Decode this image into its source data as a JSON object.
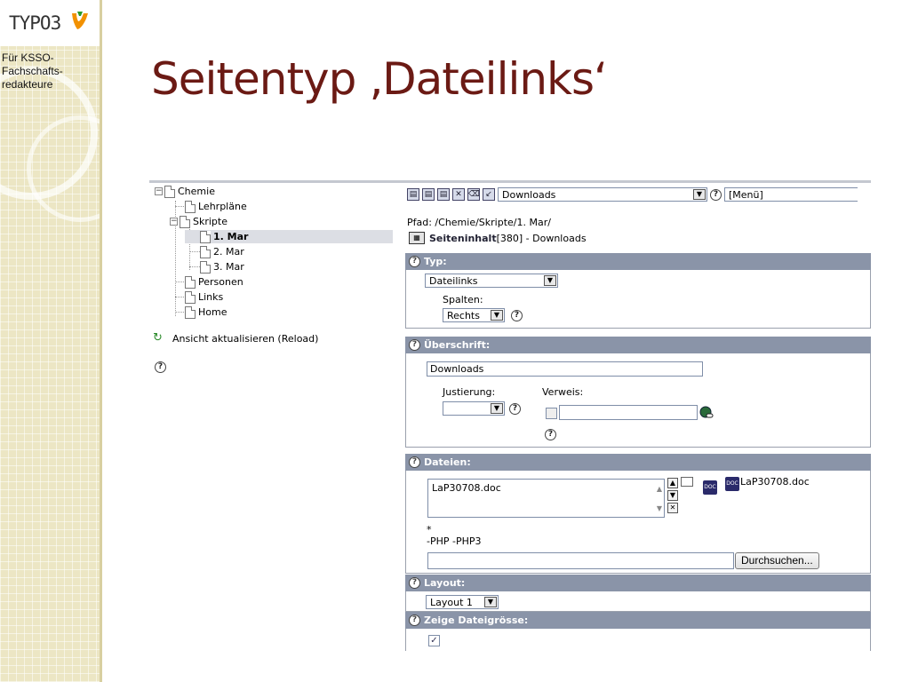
{
  "slide": {
    "title": "Seitentyp ‚Dateilinks‘",
    "logo_text": "TYPO3",
    "caption_lines": [
      "Für KSSO-",
      "Fachschafts-",
      "redakteure"
    ]
  },
  "tree": {
    "nodes": [
      {
        "label": "Chemie"
      },
      {
        "label": "Lehrpläne"
      },
      {
        "label": "Skripte"
      },
      {
        "label": "1. Mar"
      },
      {
        "label": "2. Mar"
      },
      {
        "label": "3. Mar"
      },
      {
        "label": "Personen"
      },
      {
        "label": "Links"
      },
      {
        "label": "Home"
      }
    ],
    "reload_label": "Ansicht aktualisieren (Reload)",
    "help_glyph": "?",
    "collapse_glyph": "−"
  },
  "form": {
    "toolbar": {
      "record_select": "Downloads",
      "menu_select": "[Menü]"
    },
    "path": "Pfad: /Chemie/Skripte/1. Mar/",
    "content_ref": {
      "title": "Seiteninhalt",
      "rest": " [380] - Downloads"
    },
    "typ": {
      "header": "Typ:",
      "type_value": "Dateilinks",
      "spalten_label": "Spalten:",
      "spalten_value": "Rechts"
    },
    "ueberschrift": {
      "header": "Überschrift:",
      "value": "Downloads",
      "justierung_label": "Justierung:",
      "justierung_value": "",
      "verweis_label": "Verweis:",
      "verweis_value": ""
    },
    "dateien": {
      "header": "Dateien:",
      "list_item": "LaP30708.doc",
      "file_thumb_name": "LaP30708.doc",
      "allowed_star": "*",
      "disallowed": "-PHP -PHP3",
      "browse_label": "Durchsuchen...",
      "doc_glyph": "DOC"
    },
    "layout": {
      "header": "Layout:",
      "value": "Layout 1"
    },
    "dateigroesse": {
      "header": "Zeige Dateigrösse:",
      "checked_glyph": "✓"
    }
  },
  "colors": {
    "title": "#6b1a14",
    "section_header": "#8a94a8",
    "band": "#ece6c4"
  }
}
